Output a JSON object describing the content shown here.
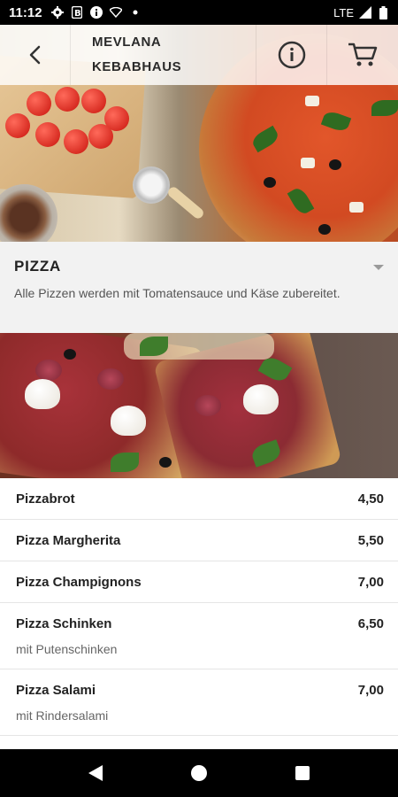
{
  "status_bar": {
    "time": "11:12",
    "network": "LTE",
    "icons": [
      "gear-icon",
      "b-badge-icon",
      "info-circle-icon",
      "wifi-icon",
      "dot-icon",
      "signal-icon",
      "battery-icon"
    ]
  },
  "app_bar": {
    "title_line1": "MEVLANA",
    "title_line2": "KEBABHAUS",
    "icons": [
      "back-icon",
      "info-icon",
      "cart-icon"
    ]
  },
  "category": {
    "title": "PIZZA",
    "description": "Alle Pizzen werden mit Tomatensauce und Käse zubereitet."
  },
  "menu_items": [
    {
      "name": "Pizzabrot",
      "price": "4,50",
      "sub": ""
    },
    {
      "name": "Pizza Margherita",
      "price": "5,50",
      "sub": ""
    },
    {
      "name": "Pizza Champignons",
      "price": "7,00",
      "sub": ""
    },
    {
      "name": "Pizza Schinken",
      "price": "6,50",
      "sub": "mit Putenschinken"
    },
    {
      "name": "Pizza Salami",
      "price": "7,00",
      "sub": "mit Rindersalami"
    }
  ],
  "nav_bar": {
    "icons": [
      "nav-back-icon",
      "nav-home-icon",
      "nav-recents-icon"
    ]
  },
  "colors": {
    "status_bar": "#000000",
    "app_bar_overlay": "#ffffffd1",
    "category_bg": "#f2f2f2",
    "list_bg": "#ffffff",
    "divider": "#e5e5e5",
    "text_dark": "#222222",
    "text_muted": "#666666"
  }
}
